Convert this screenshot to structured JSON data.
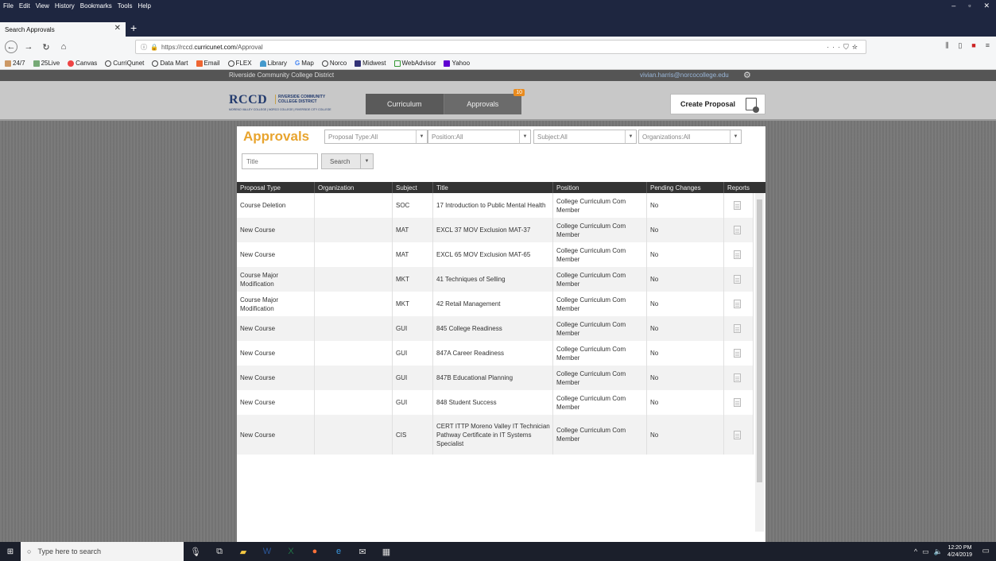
{
  "browser": {
    "menu": [
      "File",
      "Edit",
      "View",
      "History",
      "Bookmarks",
      "Tools",
      "Help"
    ],
    "tab_title": "Search Approvals",
    "url_prefix": "https://rccd.",
    "url_domain": "curricunet.com",
    "url_path": "/Approval",
    "bookmarks": [
      "24/7",
      "25Live",
      "Canvas",
      "CurriQunet",
      "Data Mart",
      "Email",
      "FLEX",
      "Library",
      "Map",
      "Norco",
      "Midwest",
      "WebAdvisor",
      "Yahoo"
    ]
  },
  "site": {
    "district": "Riverside Community College District",
    "user_email": "vivian.harris@norcocollege.edu",
    "logo_main": "RCCD",
    "logo_side_1": "RIVERSIDE COMMUNITY",
    "logo_side_2": "COLLEGE DISTRICT",
    "logo_sub": "MORENO VALLEY COLLEGE | NORCO COLLEGE | RIVERSIDE CITY COLLEGE",
    "tabs": {
      "curriculum": "Curriculum",
      "approvals": "Approvals",
      "approvals_badge": "10"
    },
    "create_proposal": "Create Proposal"
  },
  "approvals": {
    "title": "Approvals",
    "filters": {
      "proposal_type": "Proposal Type:All",
      "position": "Position:All",
      "subject": "Subject:All",
      "organizations": "Organizations:All"
    },
    "title_placeholder": "Title",
    "search_label": "Search",
    "columns": [
      "Proposal Type",
      "Organization",
      "Subject",
      "Title",
      "Position",
      "Pending Changes",
      "Reports"
    ],
    "rows": [
      {
        "type": "Course Deletion",
        "org": "",
        "subject": "SOC",
        "title": "17 Introduction to Public Mental Health",
        "position": "College Curriculum Com Member",
        "pending": "No"
      },
      {
        "type": "New Course",
        "org": "",
        "subject": "MAT",
        "title": "EXCL 37 MOV Exclusion MAT-37",
        "position": "College Curriculum Com Member",
        "pending": "No"
      },
      {
        "type": "New Course",
        "org": "",
        "subject": "MAT",
        "title": "EXCL 65 MOV Exclusion MAT-65",
        "position": "College Curriculum Com Member",
        "pending": "No"
      },
      {
        "type": "Course Major Modification",
        "org": "",
        "subject": "MKT",
        "title": "41 Techniques of Selling",
        "position": "College Curriculum Com Member",
        "pending": "No"
      },
      {
        "type": "Course Major Modification",
        "org": "",
        "subject": "MKT",
        "title": "42 Retail Management",
        "position": "College Curriculum Com Member",
        "pending": "No"
      },
      {
        "type": "New Course",
        "org": "",
        "subject": "GUI",
        "title": "845 College Readiness",
        "position": "College Curriculum Com Member",
        "pending": "No"
      },
      {
        "type": "New Course",
        "org": "",
        "subject": "GUI",
        "title": "847A Career Readiness",
        "position": "College Curriculum Com Member",
        "pending": "No"
      },
      {
        "type": "New Course",
        "org": "",
        "subject": "GUI",
        "title": "847B Educational Planning",
        "position": "College Curriculum Com Member",
        "pending": "No"
      },
      {
        "type": "New Course",
        "org": "",
        "subject": "GUI",
        "title": "848 Student Success",
        "position": "College Curriculum Com Member",
        "pending": "No"
      },
      {
        "type": "New Course",
        "org": "",
        "subject": "CIS",
        "title": "CERT ITTP Moreno Valley IT Technician Pathway Certificate in IT Systems Specialist",
        "position": "College Curriculum Com Member",
        "pending": "No"
      }
    ]
  },
  "taskbar": {
    "search_placeholder": "Type here to search",
    "time": "12:20 PM",
    "date": "4/24/2019"
  }
}
